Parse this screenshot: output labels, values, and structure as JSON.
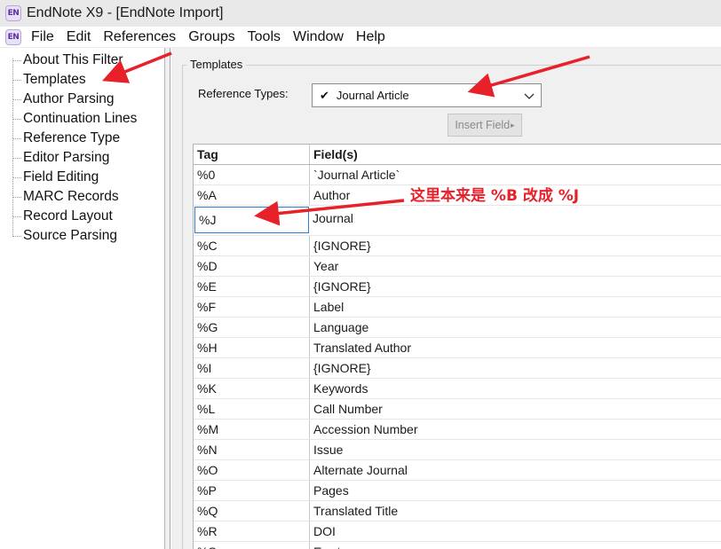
{
  "window": {
    "app_icon": "EN",
    "title": "EndNote X9 - [EndNote Import]"
  },
  "menu": [
    "File",
    "Edit",
    "References",
    "Groups",
    "Tools",
    "Window",
    "Help"
  ],
  "tree": {
    "items": [
      "About This Filter",
      "Templates",
      "Author Parsing",
      "Continuation Lines",
      "Reference Type",
      "Editor Parsing",
      "Field Editing",
      "MARC Records",
      "Record Layout",
      "Source Parsing"
    ]
  },
  "templates": {
    "group_title": "Templates",
    "reference_types_label": "Reference Types:",
    "reference_type_value": "Journal Article",
    "check_icon": "✔",
    "insert_field_label": "Insert Field",
    "insert_field_arrow": "▸",
    "columns": [
      "Tag",
      "Field(s)"
    ],
    "rows": [
      {
        "tag": "%0",
        "field": "`Journal Article`"
      },
      {
        "tag": "%A",
        "field": "Author"
      },
      {
        "tag": "%J",
        "field": "Journal"
      },
      {
        "tag": "%C",
        "field": "{IGNORE}"
      },
      {
        "tag": "%D",
        "field": "Year"
      },
      {
        "tag": "%E",
        "field": "{IGNORE}"
      },
      {
        "tag": "%F",
        "field": "Label"
      },
      {
        "tag": "%G",
        "field": "Language"
      },
      {
        "tag": "%H",
        "field": "Translated Author"
      },
      {
        "tag": "%I",
        "field": "{IGNORE}"
      },
      {
        "tag": "%K",
        "field": "Keywords"
      },
      {
        "tag": "%L",
        "field": "Call Number"
      },
      {
        "tag": "%M",
        "field": "Accession Number"
      },
      {
        "tag": "%N",
        "field": "Issue"
      },
      {
        "tag": "%O",
        "field": "Alternate Journal"
      },
      {
        "tag": "%P",
        "field": "Pages"
      },
      {
        "tag": "%Q",
        "field": "Translated Title"
      },
      {
        "tag": "%R",
        "field": "DOI"
      },
      {
        "tag": "%S",
        "field": "Errata"
      }
    ]
  },
  "annotation": {
    "note": "这里本来是 %B 改成 %J",
    "color": "#e8202a"
  }
}
